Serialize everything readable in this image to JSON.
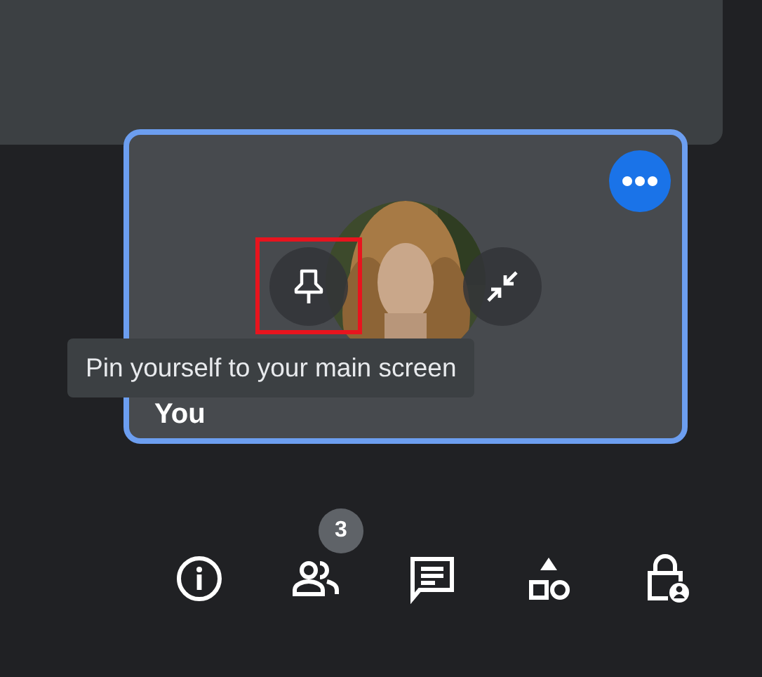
{
  "tile": {
    "name": "You",
    "tooltip": "Pin yourself to your main screen",
    "highlight": true
  },
  "toolbar": [
    {
      "kind": "info"
    },
    {
      "kind": "people",
      "badge": "3"
    },
    {
      "kind": "chat"
    },
    {
      "kind": "activities"
    },
    {
      "kind": "host-controls"
    }
  ]
}
